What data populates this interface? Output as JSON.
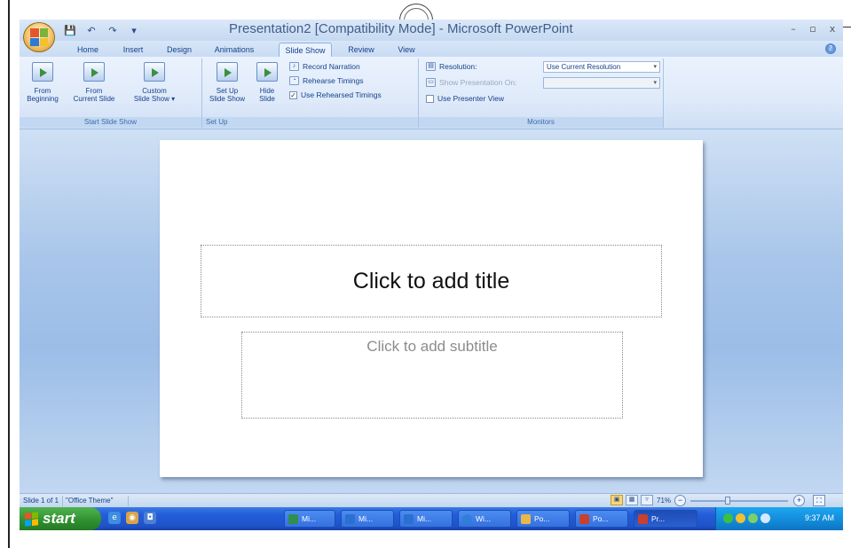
{
  "window": {
    "title": "Presentation2 [Compatibility Mode] - Microsoft PowerPoint",
    "controls": {
      "minimize": "–",
      "maximize": "▫",
      "close": "x"
    }
  },
  "qat": {
    "save": "💾",
    "undo": "↶",
    "redo": "↷",
    "customize": "▾"
  },
  "tabs": [
    {
      "label": "Home"
    },
    {
      "label": "Insert"
    },
    {
      "label": "Design"
    },
    {
      "label": "Animations"
    },
    {
      "label": "Slide Show",
      "active": true
    },
    {
      "label": "Review"
    },
    {
      "label": "View"
    }
  ],
  "ribbon": {
    "start_slide_show": {
      "label": "Start Slide Show",
      "from_beginning": {
        "line1": "From",
        "line2": "Beginning"
      },
      "from_current": {
        "line1": "From",
        "line2": "Current Slide"
      },
      "custom": {
        "line1": "Custom",
        "line2": "Slide Show ▾"
      }
    },
    "set_up": {
      "label": "Set Up",
      "set_up_show": {
        "line1": "Set Up",
        "line2": "Slide Show"
      },
      "hide_slide": {
        "line1": "Hide",
        "line2": "Slide"
      },
      "record_narration": "Record Narration",
      "rehearse_timings": "Rehearse Timings",
      "use_rehearsed_timings": "Use Rehearsed Timings"
    },
    "monitors": {
      "label": "Monitors",
      "resolution_label": "Resolution:",
      "resolution_value": "Use Current Resolution",
      "show_on_label": "Show Presentation On:",
      "show_on_value": "",
      "presenter_view": "Use Presenter View"
    }
  },
  "slide": {
    "title_placeholder": "Click to add title",
    "subtitle_placeholder": "Click to add subtitle"
  },
  "statusbar": {
    "slide_counter": "Slide 1 of 1",
    "theme": "\"Office Theme\"",
    "zoom": "71%",
    "zoom_out": "−",
    "zoom_in": "+"
  },
  "taskbar": {
    "start": "start",
    "buttons": [
      {
        "label": "Mi...",
        "color": "#2f8f4f"
      },
      {
        "label": "Mi...",
        "color": "#2b6fd0"
      },
      {
        "label": "Mi...",
        "color": "#2b6fd0"
      },
      {
        "label": "Wi...",
        "color": "#2f7fd8"
      },
      {
        "label": "Po...",
        "color": "#e9b84a"
      },
      {
        "label": "Po...",
        "color": "#c8402e"
      },
      {
        "label": "Pr...",
        "color": "#c8402e",
        "active": true
      }
    ],
    "clock": "9:37 AM"
  }
}
